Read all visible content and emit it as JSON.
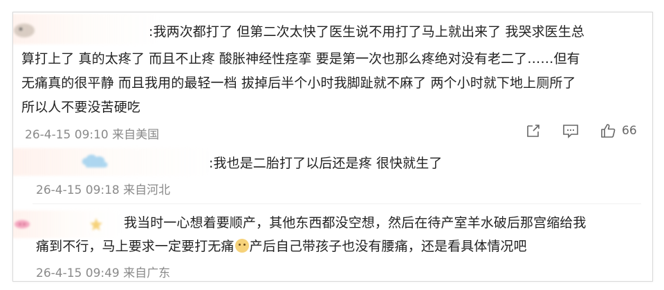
{
  "comment1": {
    "line1": ":我两次都打了 但第二次太快了医生说不用打了马上就出来了 我哭求医生总",
    "line2": "算打上了 真的太疼了 而且不止疼 酸胀神经性痉挛 要是第一次也那么疼绝对没有老二了……但有",
    "line3": "无痛真的很平静 而且我用的最轻一档 拔掉后半个小时我脚趾就不麻了 两个小时就下地上厕所了",
    "line4": "所以人不要没苦硬吃",
    "meta": "26-4-15 09:10 来自美国",
    "like_count": "66",
    "icons": [
      "share-icon",
      "comment-icon",
      "like-icon"
    ]
  },
  "reply1": {
    "text": ":我也是二胎打了以后还是疼 很快就生了",
    "meta": "26-4-15 09:18 来自河北"
  },
  "reply2": {
    "line1": "我当时一心想着要顺产，其他东西都没空想，然后在待产室羊水破后那宫缩给我",
    "line2_a": "痛到不行，马上要求一定要打无痛",
    "line2_b": "产后自己带孩子也没有腰痛，还是看具体情况吧",
    "meta": "26-4-15 09:49 来自广东"
  },
  "colors": {
    "text": "#222222",
    "meta": "#8a8a8a",
    "border": "#d9d9d9"
  }
}
